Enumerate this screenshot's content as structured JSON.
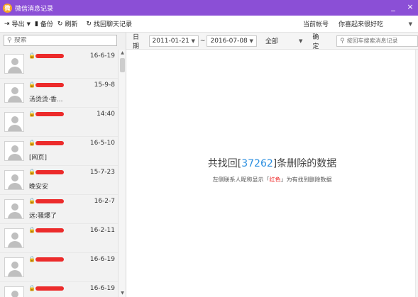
{
  "window": {
    "title": "微信消息记录",
    "logo_glyph": "微",
    "minimize_glyph": "_",
    "close_glyph": "×"
  },
  "toolbar": {
    "export_label": "导出",
    "backup_label": "备份",
    "refresh_label": "刷新",
    "recover_label": "找回聊天记录",
    "account_label": "当前帐号",
    "account_value": "你喜起来很好吃"
  },
  "search": {
    "placeholder": "搜索"
  },
  "contacts": [
    {
      "date": "16-6-19",
      "snippet": ""
    },
    {
      "date": "15-9-8",
      "snippet": "汤烫烫·香..."
    },
    {
      "date": "14:40",
      "snippet": ""
    },
    {
      "date": "16-5-10",
      "snippet": "[网页]"
    },
    {
      "date": "15-7-23",
      "snippet": "晚安安"
    },
    {
      "date": "16-2-7",
      "snippet": "远:骚爆了"
    },
    {
      "date": "16-2-11",
      "snippet": ""
    },
    {
      "date": "16-6-19",
      "snippet": ""
    },
    {
      "date": "16-6-19",
      "snippet": ""
    }
  ],
  "filter": {
    "date_label": "日期",
    "start_date": "2011-01-21",
    "separator": "~",
    "end_date": "2016-07-08",
    "range_value": "全部",
    "confirm_label": "确定",
    "message_search_placeholder": "按回车搜索消息记录"
  },
  "result": {
    "prefix": "共找回[",
    "count": "37262",
    "suffix": "]条删除的数据",
    "hint_before": "左侧联系人昵称显示「",
    "hint_red": "红色",
    "hint_after": "」为有找到删除数据"
  },
  "colors": {
    "titlebar": "#8b4fd6",
    "accent_blue": "#2c8fe0",
    "deleted_red": "#e22222"
  },
  "icons": {
    "lock": "lock-icon",
    "search": "search-icon"
  }
}
